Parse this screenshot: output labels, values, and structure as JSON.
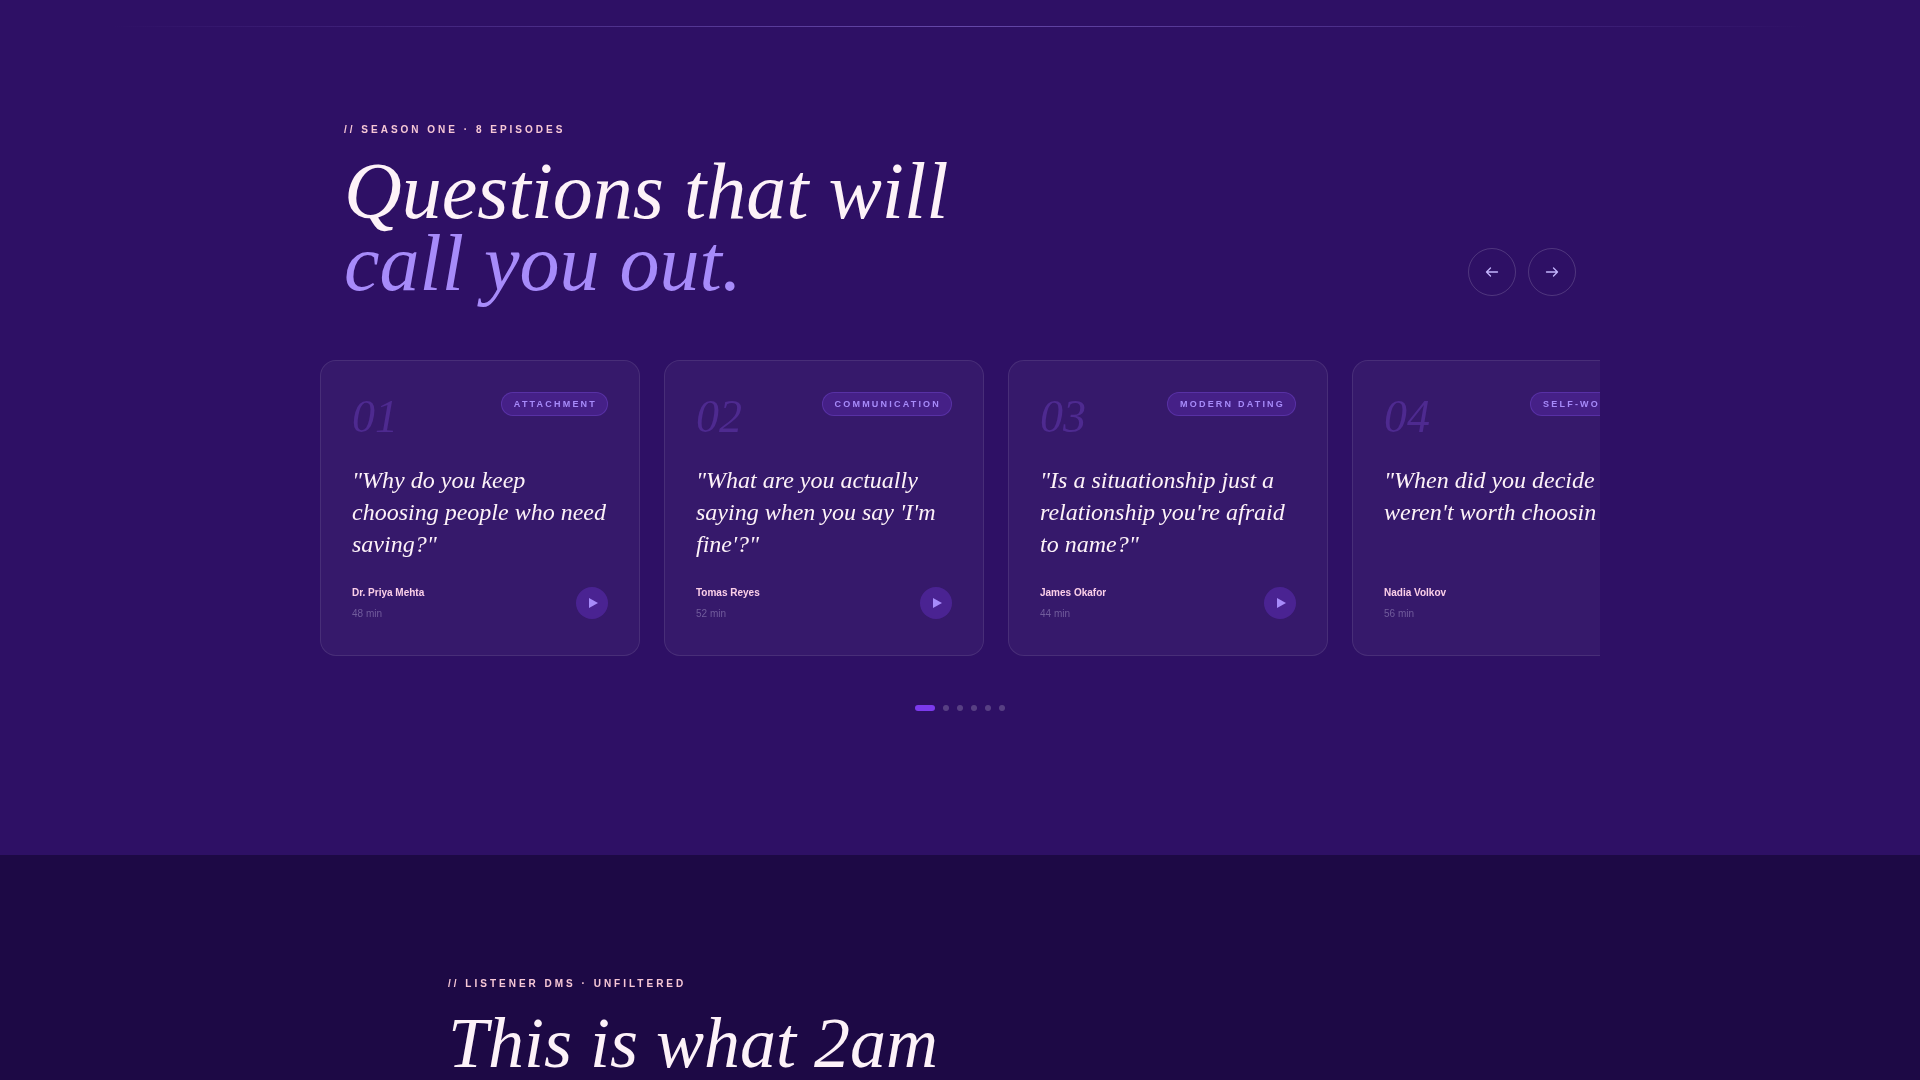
{
  "episodes_section": {
    "eyebrow": "// SEASON ONE · 8 EPISODES",
    "title": {
      "line_1": "Questions that will",
      "line_2": "call you out."
    },
    "cards": [
      {
        "number": "01",
        "tag": "ATTACHMENT",
        "quote": "\"Why do you keep choosing people who need saving?\"",
        "guest": "Dr. Priya Mehta",
        "duration": "48 min",
        "play_button": true
      },
      {
        "number": "02",
        "tag": "COMMUNICATION",
        "quote": "\"What are you actually saying when you say 'I'm fine'?\"",
        "guest": "Tomas Reyes",
        "duration": "52 min",
        "play_button": true
      },
      {
        "number": "03",
        "tag": "MODERN DATING",
        "quote": "\"Is a situationship just a relationship you're afraid to name?\"",
        "guest": "James Okafor",
        "duration": "44 min",
        "play_button": true
      },
      {
        "number": "04",
        "tag": "SELF-WO",
        "quote": "\"When did you decide weren't worth choosin",
        "guest": "Nadia Volkov",
        "duration": "56 min",
        "play_button": false
      }
    ],
    "pagination": [
      {
        "selected": true
      },
      {
        "selected": false
      },
      {
        "selected": false
      },
      {
        "selected": false
      },
      {
        "selected": false
      },
      {
        "selected": false
      }
    ]
  },
  "dms_section": {
    "eyebrow": "// LISTENER DMS · UNFILTERED",
    "title": "This is what 2am"
  }
}
